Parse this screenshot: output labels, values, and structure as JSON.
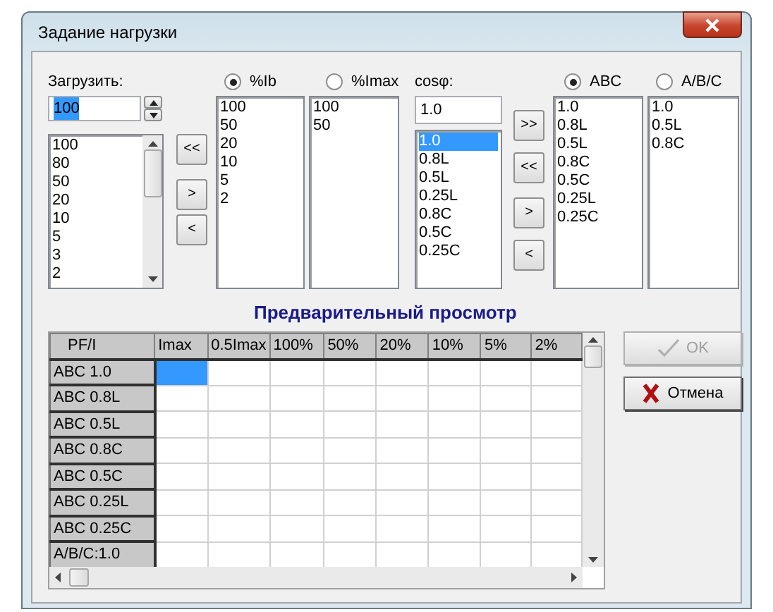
{
  "window": {
    "title": "Задание нагрузки"
  },
  "load": {
    "label": "Загрузить:",
    "value": "100",
    "items": [
      "100",
      "80",
      "50",
      "20",
      "10",
      "5",
      "3",
      "2"
    ]
  },
  "left_transfer_buttons": [
    "<<",
    ">",
    "<"
  ],
  "current_modes": [
    {
      "label": "%Ib",
      "selected": true,
      "items": [
        "100",
        "50",
        "20",
        "10",
        "5",
        "2"
      ]
    },
    {
      "label": "%Imax",
      "selected": false,
      "items": [
        "100",
        "50"
      ]
    }
  ],
  "cos": {
    "label": "cosφ:",
    "value": "1.0",
    "items": [
      {
        "label": "1.0",
        "selected": true
      },
      {
        "label": "0.8L",
        "selected": false
      },
      {
        "label": "0.5L",
        "selected": false
      },
      {
        "label": "0.25L",
        "selected": false
      },
      {
        "label": "0.8C",
        "selected": false
      },
      {
        "label": "0.5C",
        "selected": false
      },
      {
        "label": "0.25C",
        "selected": false
      }
    ]
  },
  "right_transfer_buttons": [
    ">>",
    "<<",
    ">",
    "<"
  ],
  "phase_modes": [
    {
      "label": "ABC",
      "selected": true,
      "items": [
        "1.0",
        "0.8L",
        "0.5L",
        "0.8C",
        "0.5C",
        "0.25L",
        "0.25C"
      ]
    },
    {
      "label": "A/B/C",
      "selected": false,
      "items": [
        "1.0",
        "0.5L",
        "0.8C"
      ]
    }
  ],
  "preview": {
    "title": "Предварительный просмотр",
    "columns": [
      "PF/I",
      "Imax",
      "0.5Imax",
      "100%",
      "50%",
      "20%",
      "10%",
      "5%",
      "2%"
    ],
    "rows": [
      {
        "label": "ABC 1.0",
        "cells": [
          {
            "selected": true
          },
          {
            "selected": false
          },
          {
            "selected": false
          },
          {
            "selected": false
          },
          {
            "selected": false
          },
          {
            "selected": false
          },
          {
            "selected": false
          },
          {
            "selected": false
          }
        ]
      },
      {
        "label": "ABC 0.8L",
        "cells": [
          {
            "selected": false
          },
          {
            "selected": false
          },
          {
            "selected": false
          },
          {
            "selected": false
          },
          {
            "selected": false
          },
          {
            "selected": false
          },
          {
            "selected": false
          },
          {
            "selected": false
          }
        ]
      },
      {
        "label": "ABC 0.5L",
        "cells": [
          {
            "selected": false
          },
          {
            "selected": false
          },
          {
            "selected": false
          },
          {
            "selected": false
          },
          {
            "selected": false
          },
          {
            "selected": false
          },
          {
            "selected": false
          },
          {
            "selected": false
          }
        ]
      },
      {
        "label": "ABC 0.8C",
        "cells": [
          {
            "selected": false
          },
          {
            "selected": false
          },
          {
            "selected": false
          },
          {
            "selected": false
          },
          {
            "selected": false
          },
          {
            "selected": false
          },
          {
            "selected": false
          },
          {
            "selected": false
          }
        ]
      },
      {
        "label": "ABC 0.5C",
        "cells": [
          {
            "selected": false
          },
          {
            "selected": false
          },
          {
            "selected": false
          },
          {
            "selected": false
          },
          {
            "selected": false
          },
          {
            "selected": false
          },
          {
            "selected": false
          },
          {
            "selected": false
          }
        ]
      },
      {
        "label": "ABC 0.25L",
        "cells": [
          {
            "selected": false
          },
          {
            "selected": false
          },
          {
            "selected": false
          },
          {
            "selected": false
          },
          {
            "selected": false
          },
          {
            "selected": false
          },
          {
            "selected": false
          },
          {
            "selected": false
          }
        ]
      },
      {
        "label": "ABC 0.25C",
        "cells": [
          {
            "selected": false
          },
          {
            "selected": false
          },
          {
            "selected": false
          },
          {
            "selected": false
          },
          {
            "selected": false
          },
          {
            "selected": false
          },
          {
            "selected": false
          },
          {
            "selected": false
          }
        ]
      },
      {
        "label": "A/B/C:1.0",
        "cells": [
          {
            "selected": false
          },
          {
            "selected": false
          },
          {
            "selected": false
          },
          {
            "selected": false
          },
          {
            "selected": false
          },
          {
            "selected": false
          },
          {
            "selected": false
          },
          {
            "selected": false
          }
        ]
      }
    ]
  },
  "buttons": [
    {
      "kind": "ok",
      "label": "OK",
      "disabled": true
    },
    {
      "kind": "cancel",
      "label": "Отмена",
      "disabled": false
    }
  ]
}
